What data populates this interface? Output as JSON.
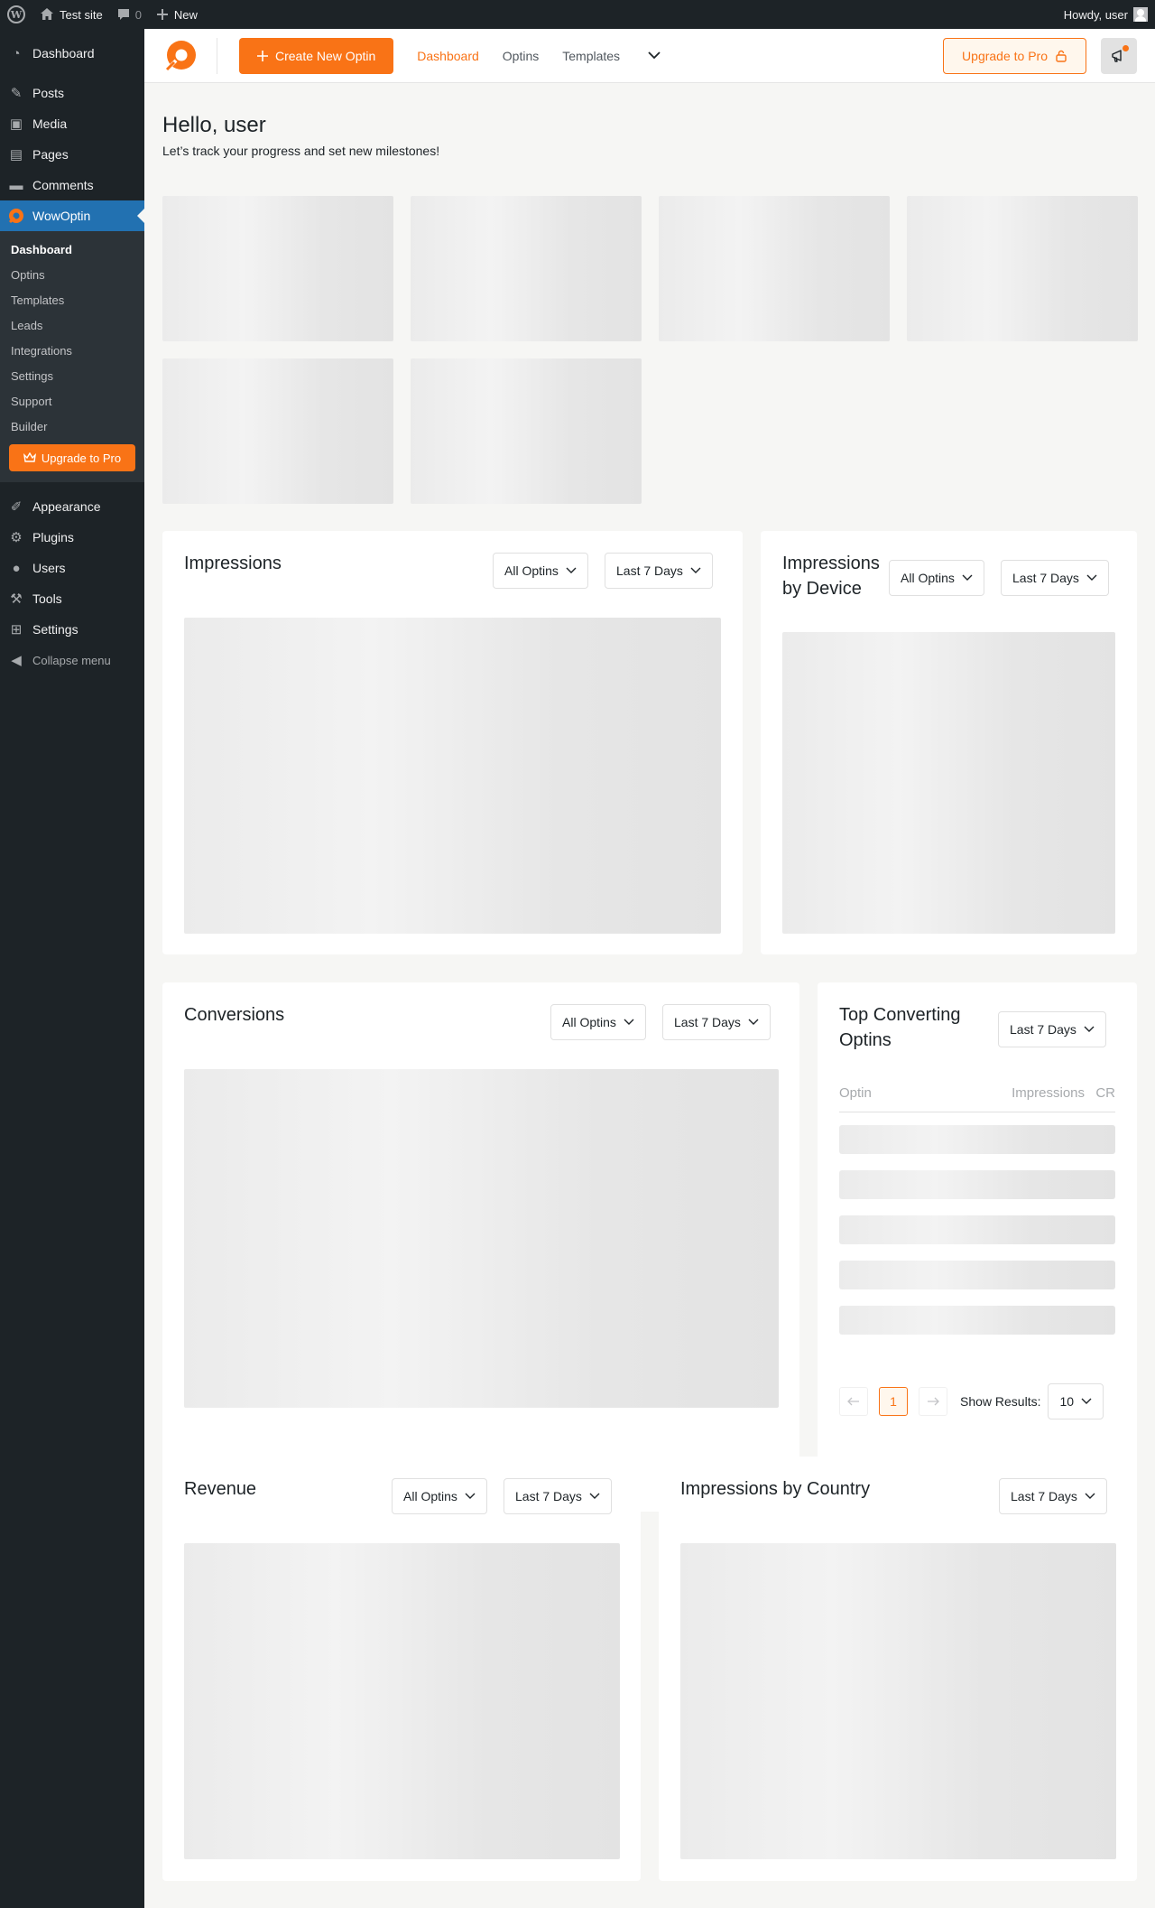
{
  "admin_bar": {
    "site_name": "Test site",
    "comments_count": "0",
    "new_label": "New",
    "greeting": "Howdy, user"
  },
  "sidebar": {
    "items_top": [
      {
        "label": "Dashboard",
        "icon": "dashboard-icon"
      },
      {
        "label": "Posts",
        "icon": "pin-icon"
      },
      {
        "label": "Media",
        "icon": "media-icon"
      },
      {
        "label": "Pages",
        "icon": "pages-icon"
      },
      {
        "label": "Comments",
        "icon": "comments-icon"
      }
    ],
    "active_item": {
      "label": "WowOptin",
      "icon": "wowoptin-icon"
    },
    "submenu": [
      "Dashboard",
      "Optins",
      "Templates",
      "Leads",
      "Integrations",
      "Settings",
      "Support",
      "Builder"
    ],
    "submenu_upgrade": "Upgrade to Pro",
    "items_bottom": [
      {
        "label": "Appearance",
        "icon": "appearance-icon"
      },
      {
        "label": "Plugins",
        "icon": "plugins-icon"
      },
      {
        "label": "Users",
        "icon": "users-icon"
      },
      {
        "label": "Tools",
        "icon": "tools-icon"
      },
      {
        "label": "Settings",
        "icon": "settings-icon"
      }
    ],
    "collapse_label": "Collapse menu"
  },
  "header": {
    "create_button": "Create New Optin",
    "nav": [
      "Dashboard",
      "Optins",
      "Templates"
    ],
    "active_nav": "Dashboard",
    "upgrade_button": "Upgrade to Pro",
    "accent_color": "#f97316"
  },
  "greeting": {
    "title": "Hello, user",
    "subtitle": "Let’s track your progress and set new milestones!"
  },
  "panels": {
    "impressions": {
      "title": "Impressions",
      "filter_optins": "All Optins",
      "filter_range": "Last 7 Days"
    },
    "impressions_device": {
      "title": "Impressions by Device",
      "filter_optins": "All Optins",
      "filter_range": "Last 7 Days"
    },
    "conversions": {
      "title": "Conversions",
      "filter_optins": "All Optins",
      "filter_range": "Last 7 Days"
    },
    "top_converting": {
      "title": "Top Converting Optins",
      "filter_range": "Last 7 Days",
      "columns": [
        "Optin",
        "Impressions",
        "CR"
      ],
      "current_page": "1",
      "show_results_label": "Show Results:",
      "show_results_value": "10"
    },
    "revenue": {
      "title": "Revenue",
      "filter_optins": "All Optins",
      "filter_range": "Last 7 Days"
    },
    "impressions_country": {
      "title": "Impressions by Country",
      "filter_range": "Last 7 Days"
    }
  }
}
